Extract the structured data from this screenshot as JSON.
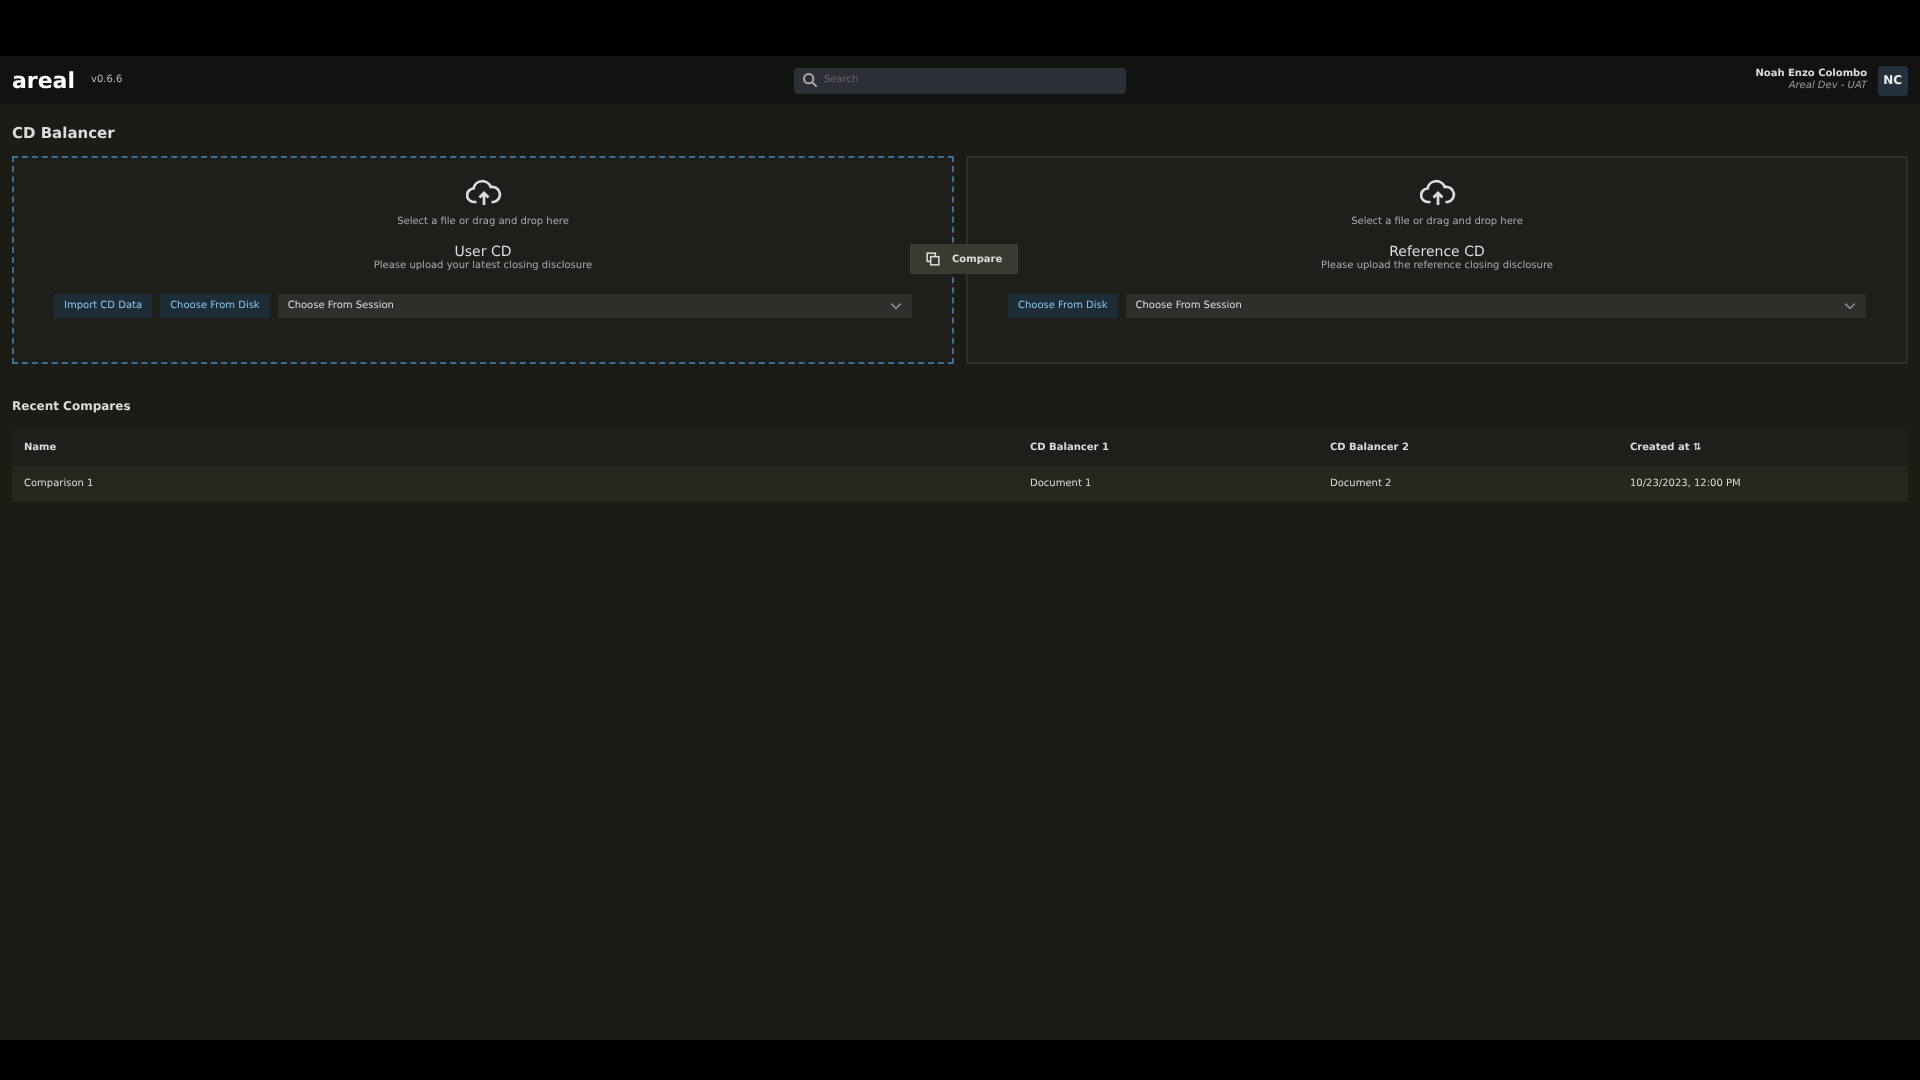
{
  "header": {
    "logo": "areal",
    "version": "v0.6.6",
    "search": {
      "placeholder": "Search"
    },
    "user": {
      "name": "Noah Enzo Colombo",
      "org": "Areal Dev - UAT",
      "initials": "NC"
    }
  },
  "page_title": "CD Balancer",
  "dropzones": [
    {
      "selected": true,
      "hint": "Select a file or drag and drop here",
      "title": "User CD",
      "subtitle": "Please upload your latest closing disclosure",
      "buttons": [
        "Import CD Data",
        "Choose From Disk"
      ],
      "select": "Choose From Session"
    },
    {
      "selected": false,
      "hint": "Select a file or drag and drop here",
      "title": "Reference CD",
      "subtitle": "Please upload the reference closing disclosure",
      "buttons": [
        "Choose From Disk"
      ],
      "select": "Choose From Session"
    }
  ],
  "compare_button": "Compare",
  "recent": {
    "title": "Recent Compares",
    "columns": [
      "Name",
      "CD Balancer 1",
      "CD Balancer 2",
      "Created at ⇅"
    ],
    "rows": [
      [
        "Comparison 1",
        "Document 1",
        "Document 2",
        "10/23/2023, 12:00 PM"
      ]
    ]
  }
}
